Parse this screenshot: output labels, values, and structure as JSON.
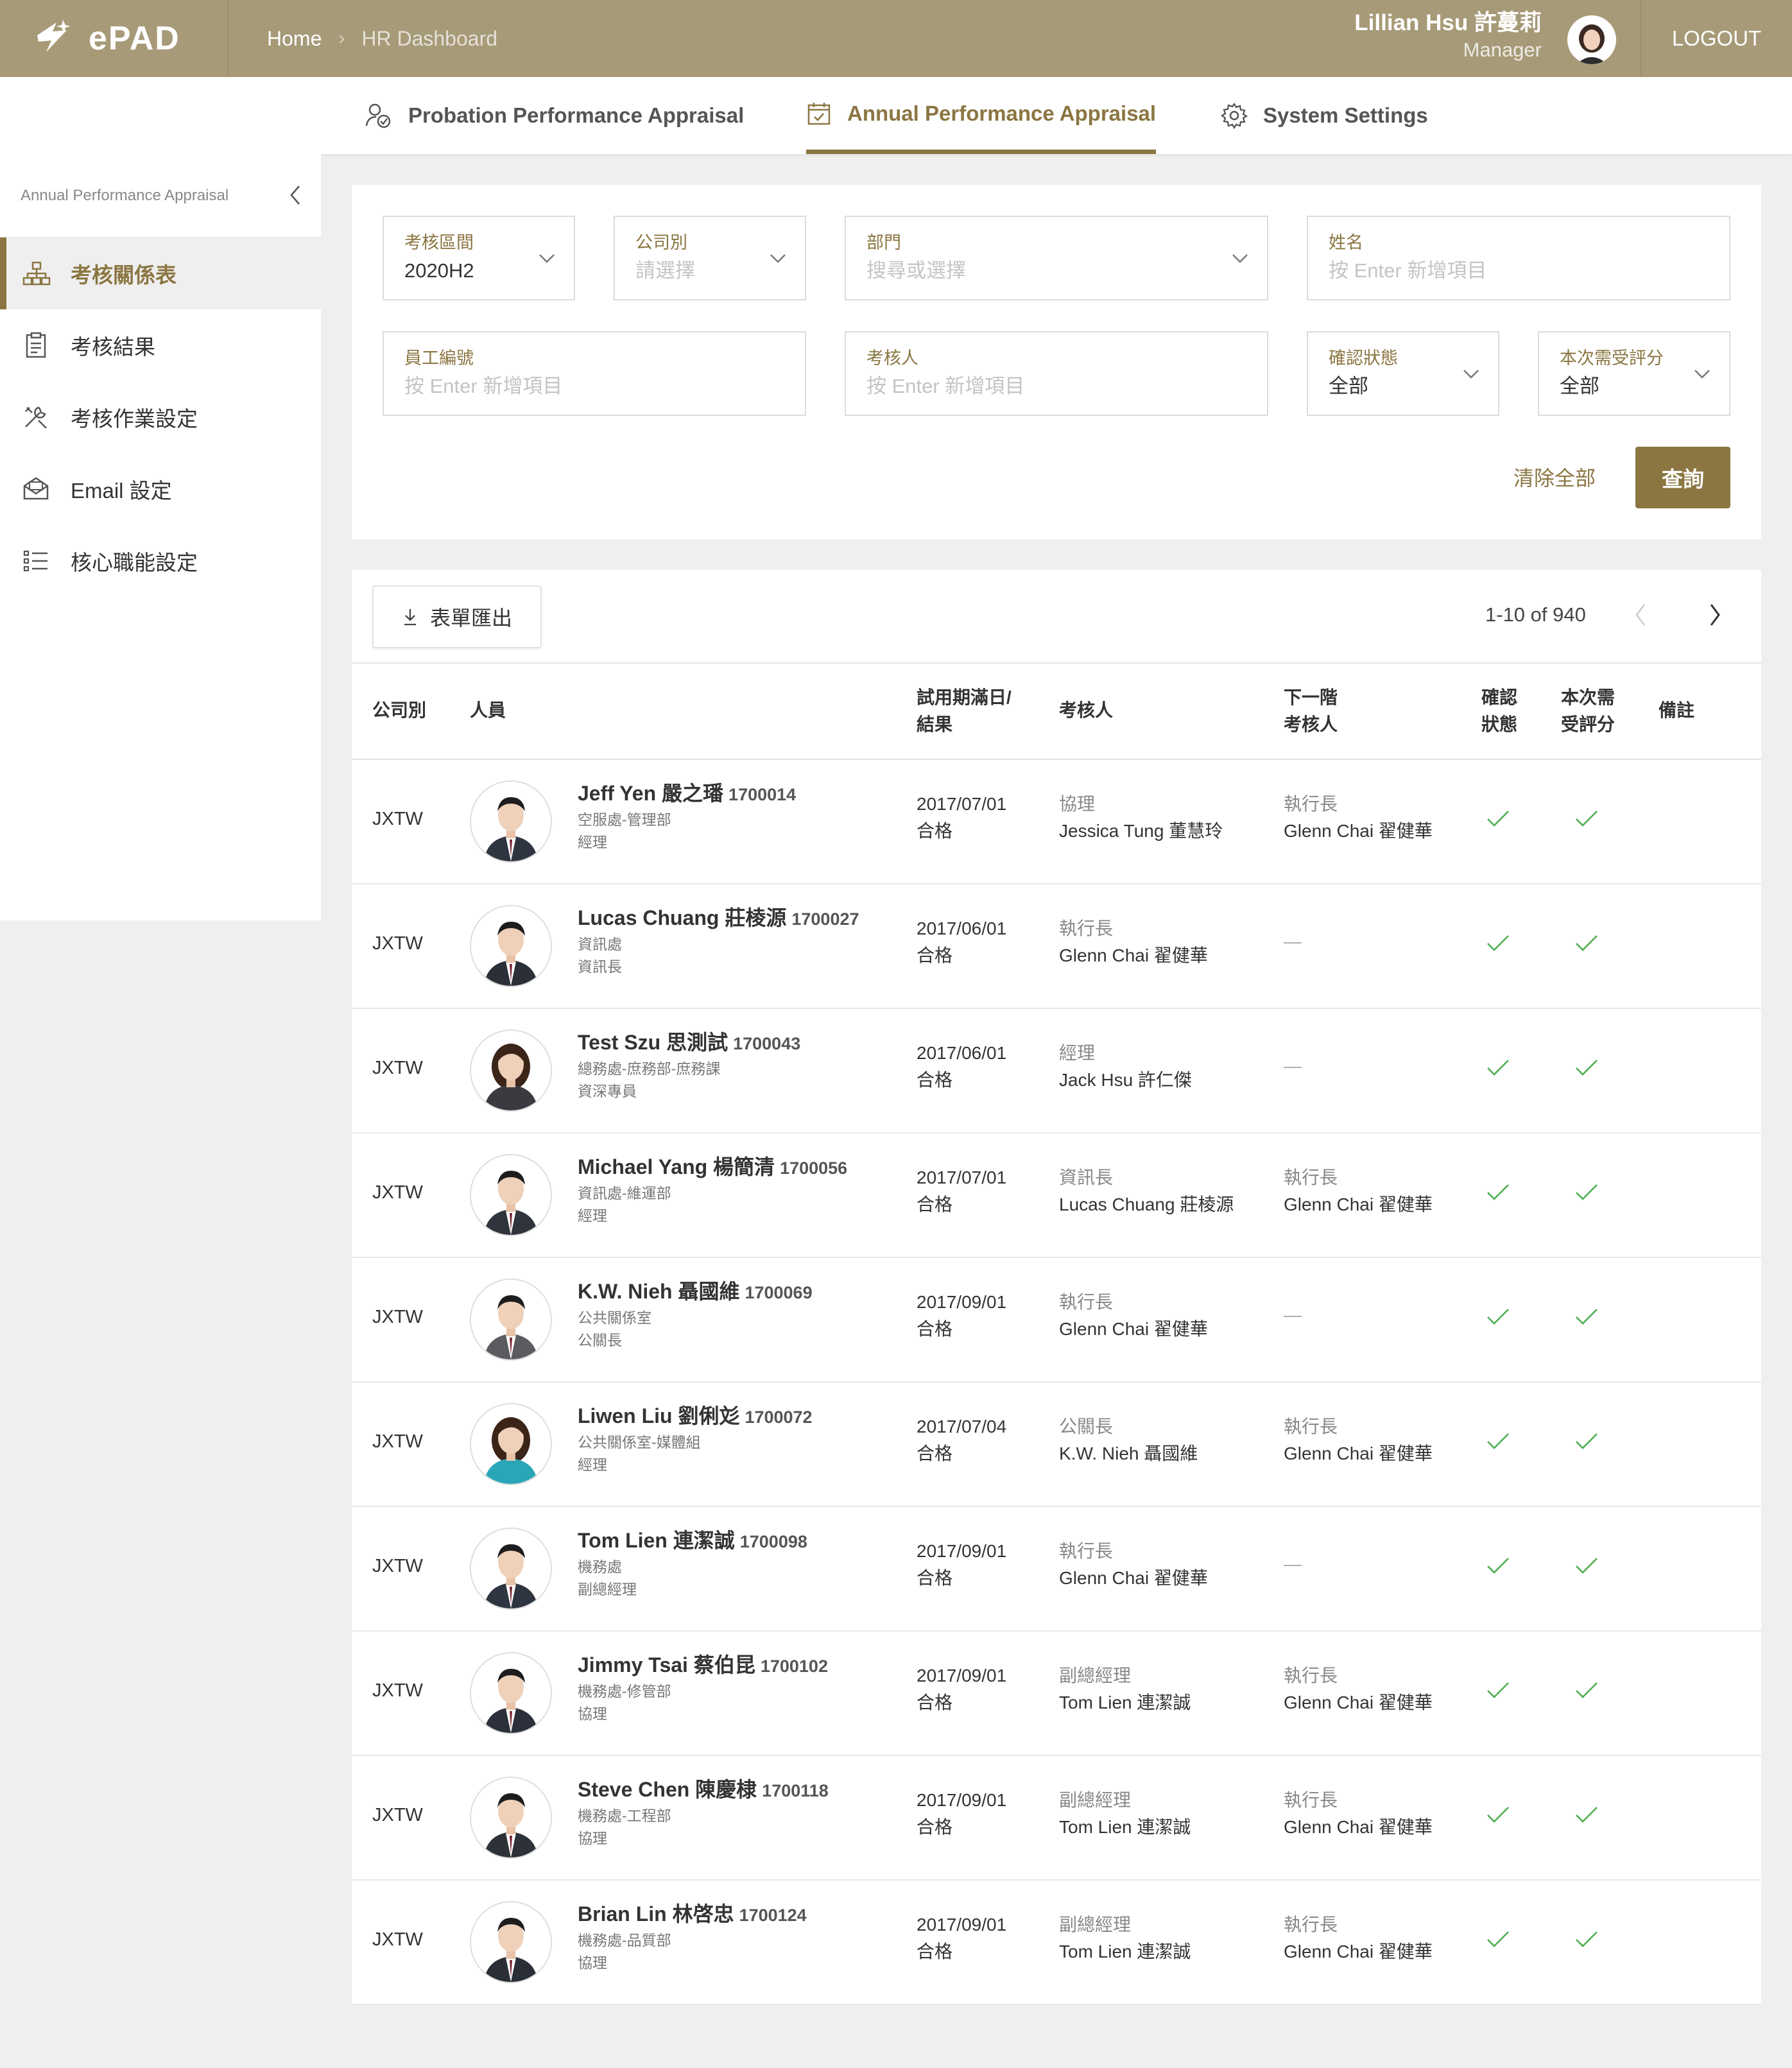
{
  "header": {
    "logo_text": "ePAD",
    "breadcrumb": [
      "Home",
      "HR Dashboard"
    ],
    "user_name": "Lillian Hsu 許蔓莉",
    "user_role": "Manager",
    "logout_label": "LOGOUT"
  },
  "tabs": [
    {
      "label": "Probation Performance Appraisal",
      "icon": "person-check-icon"
    },
    {
      "label": "Annual Performance Appraisal",
      "icon": "calendar-check-icon",
      "active": true
    },
    {
      "label": "System Settings",
      "icon": "gear-icon"
    }
  ],
  "sidebar": {
    "title": "Annual Performance Appraisal",
    "items": [
      {
        "label": "考核關係表",
        "icon": "org-chart-icon",
        "active": true
      },
      {
        "label": "考核結果",
        "icon": "clipboard-icon"
      },
      {
        "label": "考核作業設定",
        "icon": "tools-icon"
      },
      {
        "label": "Email 設定",
        "icon": "mail-icon"
      },
      {
        "label": "核心職能設定",
        "icon": "list-icon"
      }
    ]
  },
  "filters": {
    "period": {
      "label": "考核區間",
      "value": "2020H2"
    },
    "company": {
      "label": "公司別",
      "placeholder": "請選擇"
    },
    "department": {
      "label": "部門",
      "placeholder": "搜尋或選擇"
    },
    "name": {
      "label": "姓名",
      "placeholder": "按 Enter 新增項目"
    },
    "employee_id": {
      "label": "員工編號",
      "placeholder": "按 Enter 新增項目"
    },
    "reviewer": {
      "label": "考核人",
      "placeholder": "按 Enter 新增項目"
    },
    "status": {
      "label": "確認狀態",
      "value": "全部"
    },
    "need_score": {
      "label": "本次需受評分",
      "value": "全部"
    },
    "clear_label": "清除全部",
    "query_label": "查詢"
  },
  "table": {
    "export_label": "表單匯出",
    "pager": "1-10 of 940",
    "headers": {
      "company": "公司別",
      "person": "人員",
      "date_1": "試用期滿日/",
      "date_2": "結果",
      "reviewer": "考核人",
      "next_1": "下一階",
      "next_2": "考核人",
      "status_1": "確認",
      "status_2": "狀態",
      "score_1": "本次需",
      "score_2": "受評分",
      "note": "備註"
    },
    "rows": [
      {
        "company": "JXTW",
        "name": "Jeff Yen 嚴之璠",
        "id": "1700014",
        "dept": "空服處-管理部",
        "title": "經理",
        "date": "2017/07/01",
        "result": "合格",
        "reviewer_title": "協理",
        "reviewer_name": "Jessica Tung 董慧玲",
        "next_title": "執行長",
        "next_name": "Glenn Chai 翟健華",
        "photo": "male",
        "suit": "#2f3540"
      },
      {
        "company": "JXTW",
        "name": "Lucas Chuang 莊棱源",
        "id": "1700027",
        "dept": "資訊處",
        "title": "資訊長",
        "date": "2017/06/01",
        "result": "合格",
        "reviewer_title": "執行長",
        "reviewer_name": "Glenn Chai 翟健華",
        "next_title": "",
        "next_name": "—",
        "photo": "male",
        "suit": "#2b2f38"
      },
      {
        "company": "JXTW",
        "name": "Test Szu 思測試",
        "id": "1700043",
        "dept": "總務處-庶務部-庶務課",
        "title": "資深專員",
        "date": "2017/06/01",
        "result": "合格",
        "reviewer_title": "經理",
        "reviewer_name": "Jack Hsu 許仁傑",
        "next_title": "",
        "next_name": "—",
        "photo": "female",
        "suit": "#3a3a40"
      },
      {
        "company": "JXTW",
        "name": "Michael Yang 楊簡清",
        "id": "1700056",
        "dept": "資訊處-維運部",
        "title": "經理",
        "date": "2017/07/01",
        "result": "合格",
        "reviewer_title": "資訊長",
        "reviewer_name": "Lucas Chuang 莊棱源",
        "next_title": "執行長",
        "next_name": "Glenn Chai 翟健華",
        "photo": "male",
        "suit": "#30343c"
      },
      {
        "company": "JXTW",
        "name": "K.W. Nieh 聶國維",
        "id": "1700069",
        "dept": "公共關係室",
        "title": "公關長",
        "date": "2017/09/01",
        "result": "合格",
        "reviewer_title": "執行長",
        "reviewer_name": "Glenn Chai 翟健華",
        "next_title": "",
        "next_name": "—",
        "photo": "male",
        "suit": "#5a5c60"
      },
      {
        "company": "JXTW",
        "name": "Liwen Liu 劉俐彣",
        "id": "1700072",
        "dept": "公共關係室-媒體組",
        "title": "經理",
        "date": "2017/07/04",
        "result": "合格",
        "reviewer_title": "公關長",
        "reviewer_name": "K.W. Nieh 聶國維",
        "next_title": "執行長",
        "next_name": "Glenn Chai 翟健華",
        "photo": "female",
        "suit": "#2aa6b8"
      },
      {
        "company": "JXTW",
        "name": "Tom Lien 連潔誠",
        "id": "1700098",
        "dept": "機務處",
        "title": "副總經理",
        "date": "2017/09/01",
        "result": "合格",
        "reviewer_title": "執行長",
        "reviewer_name": "Glenn Chai 翟健華",
        "next_title": "",
        "next_name": "—",
        "photo": "male",
        "suit": "#2e3440"
      },
      {
        "company": "JXTW",
        "name": "Jimmy Tsai 蔡伯昆",
        "id": "1700102",
        "dept": "機務處-修管部",
        "title": "協理",
        "date": "2017/09/01",
        "result": "合格",
        "reviewer_title": "副總經理",
        "reviewer_name": "Tom Lien 連潔誠",
        "next_title": "執行長",
        "next_name": "Glenn Chai 翟健華",
        "photo": "male",
        "suit": "#2b303a"
      },
      {
        "company": "JXTW",
        "name": "Steve Chen 陳慶棣",
        "id": "1700118",
        "dept": "機務處-工程部",
        "title": "協理",
        "date": "2017/09/01",
        "result": "合格",
        "reviewer_title": "副總經理",
        "reviewer_name": "Tom Lien 連潔誠",
        "next_title": "執行長",
        "next_name": "Glenn Chai 翟健華",
        "photo": "male",
        "suit": "#2d3138"
      },
      {
        "company": "JXTW",
        "name": "Brian Lin 林啓忠",
        "id": "1700124",
        "dept": "機務處-品質部",
        "title": "協理",
        "date": "2017/09/01",
        "result": "合格",
        "reviewer_title": "副總經理",
        "reviewer_name": "Tom Lien 連潔誠",
        "next_title": "執行長",
        "next_name": "Glenn Chai 翟健華",
        "photo": "male",
        "suit": "#2a2e36"
      }
    ]
  },
  "colors": {
    "header_bg": "#a79a78",
    "accent": "#8b7642",
    "check": "#4caf50",
    "page_bg": "#efefef"
  }
}
